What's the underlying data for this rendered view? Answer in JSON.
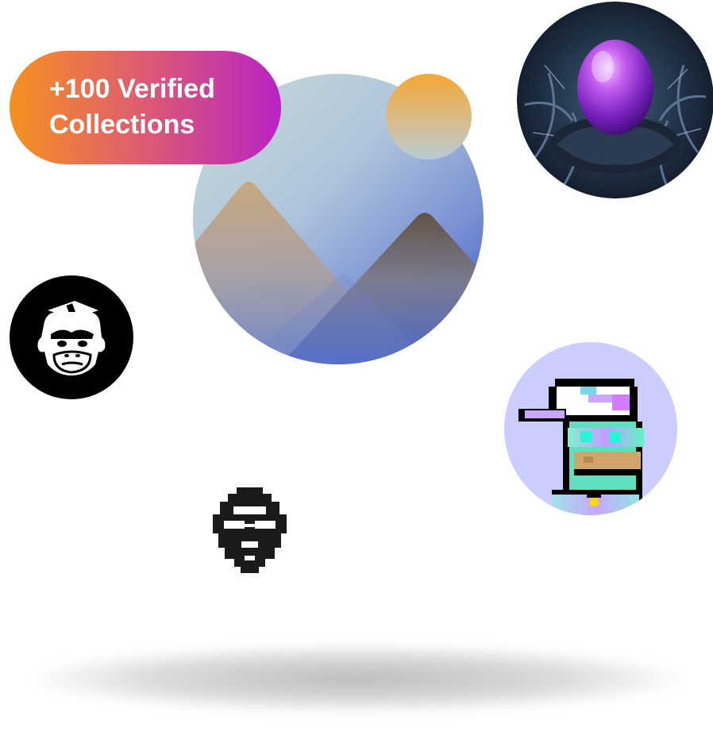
{
  "badge": {
    "line1": "+100 Verified",
    "line2": "Collections",
    "gradient": [
      "#f5911f",
      "#e0606b",
      "#b823c4"
    ]
  },
  "collections": [
    {
      "icon": "mountain-image-icon"
    },
    {
      "icon": "crystal-egg-avatar"
    },
    {
      "icon": "gorilla-logo-icon"
    },
    {
      "icon": "pixel-punk-avatar"
    },
    {
      "icon": "bearded-face-logo-icon"
    }
  ],
  "colors": {
    "background": "#ffffff",
    "punk_bg": "#ccccff"
  }
}
